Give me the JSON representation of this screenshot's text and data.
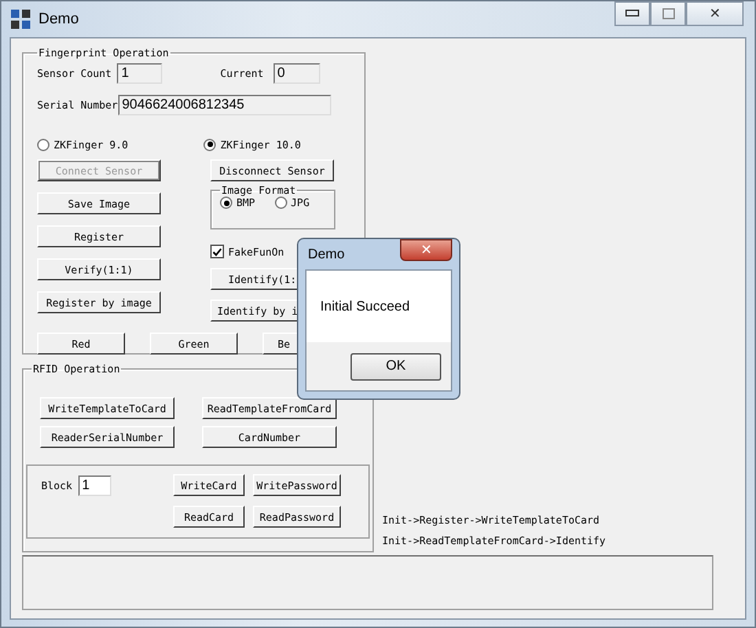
{
  "window": {
    "title": "Demo",
    "close_glyph": "✕"
  },
  "fingerprint": {
    "title": "Fingerprint Operation",
    "sensor_count": {
      "label": "Sensor Count",
      "value": "1"
    },
    "current": {
      "label": "Current",
      "value": "0"
    },
    "serial": {
      "label": "Serial Number",
      "value": "9046624006812345"
    },
    "sdk_options": [
      {
        "label": "ZKFinger 9.0",
        "selected": false
      },
      {
        "label": "ZKFinger 10.0",
        "selected": true
      }
    ],
    "connect_button": {
      "label": "Connect Sensor",
      "disabled": true
    },
    "disconnect_button": {
      "label": "Disconnect Sensor",
      "disabled": false
    },
    "image_format": {
      "title": "Image Format",
      "options": [
        {
          "label": "BMP",
          "selected": true
        },
        {
          "label": "JPG",
          "selected": false
        }
      ]
    },
    "left_buttons": [
      "Save Image",
      "Register",
      "Verify(1:1)",
      "Register by image"
    ],
    "fake_fun": {
      "label": "FakeFunOn",
      "checked": true
    },
    "right_buttons": [
      "Identify(1:",
      "Identify by i"
    ],
    "led_buttons": [
      "Red",
      "Green",
      "Be"
    ]
  },
  "rfid": {
    "title": "RFID Operation",
    "buttons": [
      "WriteTemplateToCard",
      "ReadTemplateFromCard",
      "ReaderSerialNumber",
      "CardNumber"
    ],
    "block": {
      "label": "Block",
      "value": "1"
    },
    "card_buttons": [
      "WriteCard",
      "WritePassword",
      "ReadCard",
      "ReadPassword"
    ]
  },
  "hints": [
    "Init->Register->WriteTemplateToCard",
    "Init->ReadTemplateFromCard->Identify"
  ],
  "dialog": {
    "title": "Demo",
    "message": "Initial Succeed",
    "button": "OK",
    "close_glyph": "✕"
  }
}
